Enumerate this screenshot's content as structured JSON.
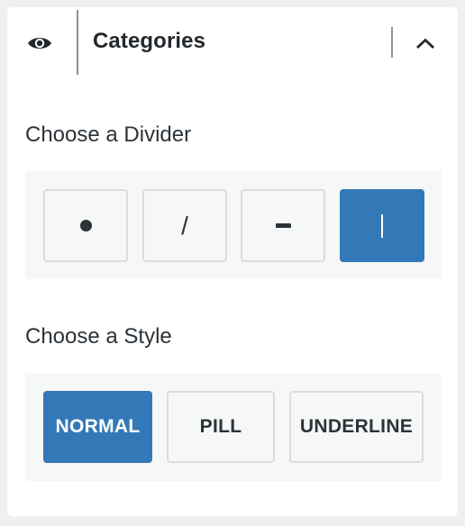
{
  "panel": {
    "title": "Categories",
    "header_icons": {
      "visibility": "eye-icon",
      "collapse": "chevron-up-icon"
    }
  },
  "divider_section": {
    "label": "Choose a Divider",
    "options": [
      {
        "id": "dot",
        "glyph": "•",
        "selected": false
      },
      {
        "id": "slash",
        "glyph": "/",
        "selected": false
      },
      {
        "id": "dash",
        "glyph": "–",
        "selected": false
      },
      {
        "id": "pipe",
        "glyph": "|",
        "selected": true
      }
    ]
  },
  "style_section": {
    "label": "Choose a Style",
    "options": [
      {
        "id": "normal",
        "label": "NORMAL",
        "selected": true
      },
      {
        "id": "pill",
        "label": "PILL",
        "selected": false
      },
      {
        "id": "underline",
        "label": "UNDERLINE",
        "selected": false
      }
    ]
  },
  "colors": {
    "accent": "#3479b7",
    "option_border": "#dcdcde",
    "option_background": "#f6f7f7",
    "text": "#2c3338"
  }
}
